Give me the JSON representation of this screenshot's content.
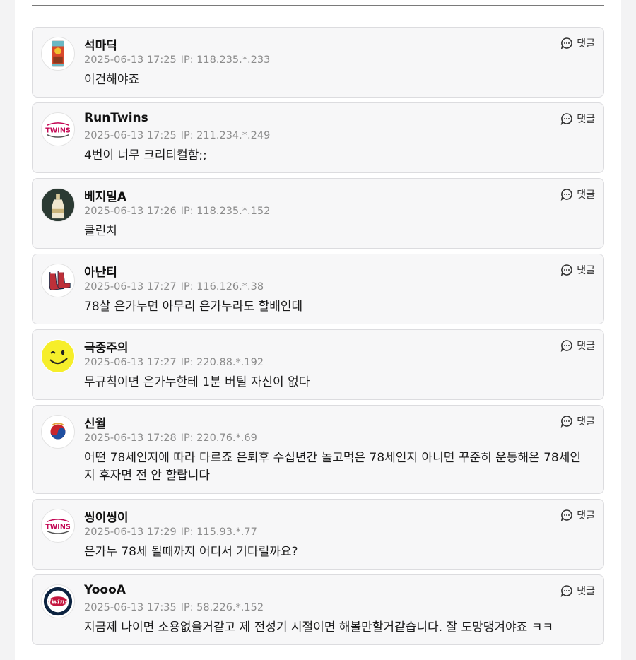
{
  "reply_label": "댓글",
  "comments": [
    {
      "nickname": "석마딕",
      "date": "2025-06-13 17:25",
      "ip": "IP: 118.235.*.233",
      "text": "이건해야죠",
      "avatar_icon": "snack-bag-avatar-icon"
    },
    {
      "nickname": "RunTwins",
      "date": "2025-06-13 17:25",
      "ip": "IP: 211.234.*.249",
      "text": "4번이 너무 크리티컬함;;",
      "avatar_icon": "lg-twins-logo-avatar-icon",
      "avatar_logo_text": "TWINS"
    },
    {
      "nickname": "베지밀A",
      "date": "2025-06-13 17:26",
      "ip": "IP: 118.235.*.152",
      "text": "클린치",
      "avatar_icon": "milk-bottle-avatar-icon"
    },
    {
      "nickname": "아난티",
      "date": "2025-06-13 17:27",
      "ip": "IP: 116.126.*.38",
      "text": "78살 은가누면 아무리 은가누라도 할배인데",
      "avatar_icon": "red-sox-avatar-icon"
    },
    {
      "nickname": "극중주의",
      "date": "2025-06-13 17:27",
      "ip": "IP: 220.88.*.192",
      "text": "무규칙이면 은가누한테 1분 버틸 자신이 없다",
      "avatar_icon": "winking-smiley-avatar-icon"
    },
    {
      "nickname": "신월",
      "date": "2025-06-13 17:28",
      "ip": "IP: 220.76.*.69",
      "text": "어떤 78세인지에 따라 다르죠 은퇴후 수십년간 놀고먹은 78세인지 아니면 꾸준히 운동해온 78세인지 후자면 전 안 할랍니다",
      "avatar_icon": "swirl-emblem-avatar-icon"
    },
    {
      "nickname": "씽이씽이",
      "date": "2025-06-13 17:29",
      "ip": "IP: 115.93.*.77",
      "text": "은가누 78세 될때까지 어디서 기다릴까요?",
      "avatar_icon": "lg-twins-logo-avatar-icon",
      "avatar_logo_text": "TWINS"
    },
    {
      "nickname": "YoooA",
      "date": "2025-06-13 17:35",
      "ip": "IP: 58.226.*.152",
      "text": "지금제 나이면 소용없을거같고 제 전성기 시절이면 해볼만할거같습니다. 잘 도망댕겨야죠 ㅋㅋ",
      "avatar_icon": "minnesota-twins-avatar-icon",
      "avatar_logo_text": "Twins"
    }
  ],
  "colors": {
    "card_bg": "#f7f7f8",
    "card_border": "#dcdcdf",
    "meta_text": "#8c8c8c",
    "twins_red": "#c30452",
    "red_sox": "#bd3039",
    "minnesota_navy": "#0c2340"
  }
}
